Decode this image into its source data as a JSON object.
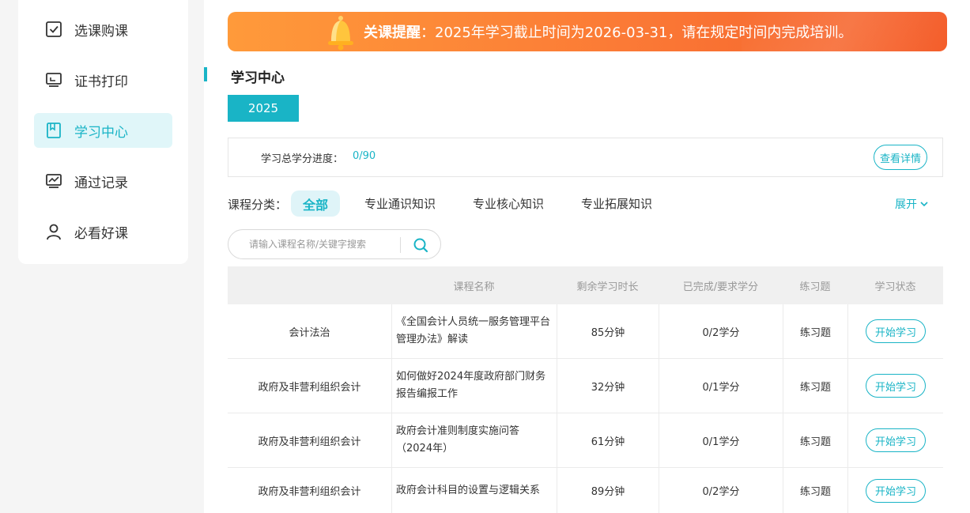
{
  "sidebar": {
    "items": [
      {
        "label": "选课购课",
        "icon": "checkbox-icon",
        "active": false
      },
      {
        "label": "证书打印",
        "icon": "monitor-print-icon",
        "active": false
      },
      {
        "label": "学习中心",
        "icon": "bookmark-icon",
        "active": true
      },
      {
        "label": "通过记录",
        "icon": "chart-monitor-icon",
        "active": false
      },
      {
        "label": "必看好课",
        "icon": "user-icon",
        "active": false
      }
    ]
  },
  "banner": {
    "icon": "bell-icon",
    "bold": "关课提醒",
    "text": "：2025年学习截止时间为2026-03-31，请在规定时间内完成培训。"
  },
  "section": {
    "title": "学习中心"
  },
  "year_tab": "2025",
  "progress": {
    "label": "学习总学分进度：",
    "value": "0/90",
    "detail_button": "查看详情"
  },
  "categories": {
    "label": "课程分类：",
    "items": [
      "全部",
      "专业通识知识",
      "专业核心知识",
      "专业拓展知识"
    ],
    "expand": "展开"
  },
  "search": {
    "placeholder": "请输入课程名称/关键字搜索",
    "icon": "search-icon"
  },
  "table": {
    "headers": [
      "",
      "课程名称",
      "剩余学习时长",
      "已完成/要求学分",
      "练习题",
      "学习状态"
    ],
    "rows": [
      {
        "category": "会计法治",
        "name": "《全国会计人员统一服务管理平台管理办法》解读",
        "remaining": "85分钟",
        "credits": "0/2学分",
        "exercise": "练习题",
        "status": "开始学习"
      },
      {
        "category": "政府及非营利组织会计",
        "name": "如何做好2024年度政府部门财务报告编报工作",
        "remaining": "32分钟",
        "credits": "0/1学分",
        "exercise": "练习题",
        "status": "开始学习"
      },
      {
        "category": "政府及非营利组织会计",
        "name": "政府会计准则制度实施问答（2024年）",
        "remaining": "61分钟",
        "credits": "0/1学分",
        "exercise": "练习题",
        "status": "开始学习"
      },
      {
        "category": "政府及非营利组织会计",
        "name": "政府会计科目的设置与逻辑关系",
        "remaining": "89分钟",
        "credits": "0/2学分",
        "exercise": "练习题",
        "status": "开始学习"
      }
    ]
  },
  "colors": {
    "accent": "#19b4c6",
    "banner_start": "#ff9a3a",
    "banner_end": "#f45d2a"
  }
}
